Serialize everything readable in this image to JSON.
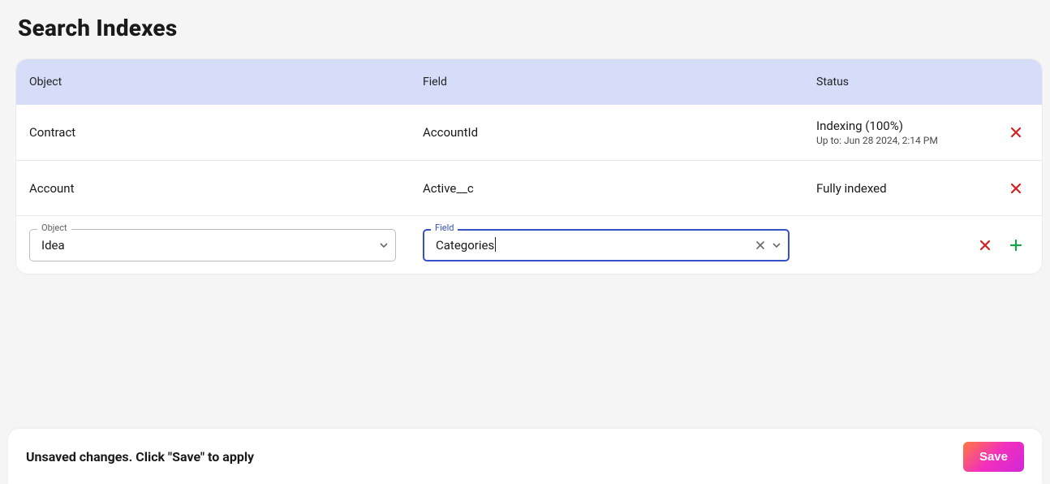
{
  "title": "Search Indexes",
  "columns": {
    "object": "Object",
    "field": "Field",
    "status": "Status"
  },
  "rows": [
    {
      "object": "Contract",
      "field": "AccountId",
      "status": "Indexing (100%)",
      "status_sub": "Up to: Jun 28 2024, 2:14 PM"
    },
    {
      "object": "Account",
      "field": "Active__c",
      "status": "Fully indexed",
      "status_sub": ""
    }
  ],
  "new_row": {
    "object_label": "Object",
    "object_value": "Idea",
    "field_label": "Field",
    "field_value": "Categories"
  },
  "footer": {
    "message": "Unsaved changes. Click \"Save\" to apply",
    "save_label": "Save"
  },
  "icons": {
    "delete": "close-icon",
    "add": "plus-icon",
    "dropdown": "caret-down-icon",
    "clear": "clear-icon"
  }
}
